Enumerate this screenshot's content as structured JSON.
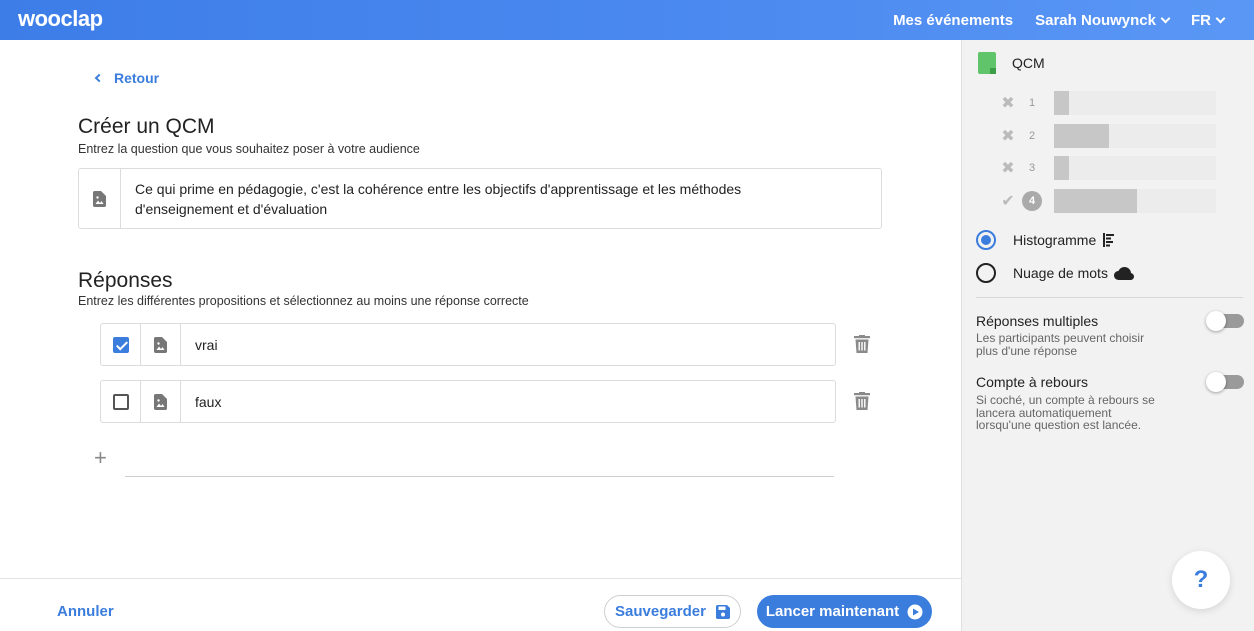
{
  "topbar": {
    "logo": "wooclap",
    "nav": {
      "events": "Mes événements",
      "user": "Sarah Nouwynck",
      "lang": "FR"
    }
  },
  "main": {
    "back_label": "Retour",
    "title": "Créer un QCM",
    "subtitle": "Entrez la question que vous souhaitez poser à votre audience",
    "question_line1": "Ce qui prime en pédagogie, c'est la cohérence entre les objectifs d'apprentissage et les méthodes",
    "question_line2": "d'enseignement et d'évaluation",
    "answers_title": "Réponses",
    "answers_subtitle": "Entrez les différentes propositions et sélectionnez au moins une réponse correcte",
    "answers": [
      {
        "text": "vrai",
        "correct": true
      },
      {
        "text": "faux",
        "correct": false
      }
    ],
    "add_symbol": "+"
  },
  "footer": {
    "cancel": "Annuler",
    "save": "Sauvegarder",
    "launch": "Lancer maintenant"
  },
  "sidebar": {
    "type_label": "QCM",
    "preview": [
      {
        "mark": "✖",
        "label": "1",
        "fill": 0.09
      },
      {
        "mark": "✖",
        "label": "2",
        "fill": 0.34
      },
      {
        "mark": "✖",
        "label": "3",
        "fill": 0.09
      },
      {
        "mark": "✔",
        "label": "4",
        "fill": 0.51
      }
    ],
    "display_options": [
      "Histogramme",
      "Nuage de mots"
    ],
    "selected_display": "Histogramme",
    "multiple": {
      "title": "Réponses multiples",
      "desc_line1": "Les participants peuvent choisir",
      "desc_line2": "plus d'une réponse",
      "enabled": false
    },
    "countdown": {
      "title": "Compte à rebours",
      "desc_line1": "Si coché, un compte à rebours se",
      "desc_line2": "lancera automatiquement",
      "desc_line3": "lorsqu'une question est lancée.",
      "enabled": false
    },
    "help_symbol": "?"
  },
  "colors": {
    "accent": "#3b7ddd",
    "topbar": "#4c8af0",
    "doc_icon": "#5fc46a"
  }
}
